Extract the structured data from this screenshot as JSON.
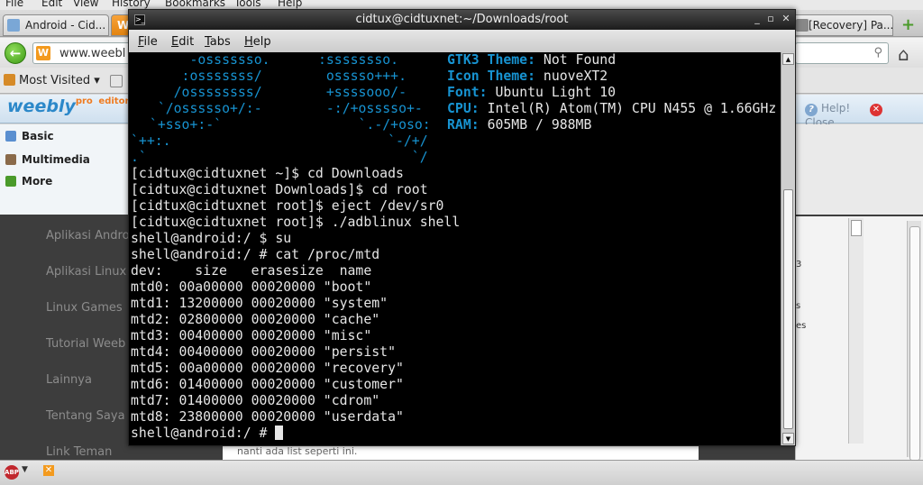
{
  "browser": {
    "menu": [
      "File",
      "Edit",
      "View",
      "History",
      "Bookmarks",
      "Tools",
      "Help"
    ],
    "tabs": [
      {
        "label": "Android - Cid..."
      },
      {
        "label": "W"
      },
      {
        "label": "[Recovery] Pa..."
      }
    ],
    "new_tab_label": "+",
    "url_partial": "www.weebl",
    "bookmarks_label": "Most Visited",
    "weebly_logo": "weebly",
    "weebly_logo_sup": "pro",
    "weebly_editor_label": "editor",
    "help_label": "Help!",
    "close_label": "Close",
    "sidebar": [
      {
        "label": "Basic"
      },
      {
        "label": "Multimedia"
      },
      {
        "label": "More"
      }
    ],
    "page_links": [
      "Aplikasi Andro",
      "Aplikasi Linux",
      "Linux Games",
      "Tutorial Weeb",
      "Lainnya",
      "Tentang Saya",
      "Link Teman"
    ],
    "page_text": "nanti ada list seperti ini.",
    "right_fragments": [
      "3",
      "s",
      "es"
    ]
  },
  "terminal": {
    "title": "cidtux@cidtuxnet:~/Downloads/root",
    "menu": [
      {
        "label": "File",
        "mnemonic": "F",
        "rest": "ile"
      },
      {
        "label": "Edit",
        "mnemonic": "E",
        "rest": "dit"
      },
      {
        "label": "Tabs",
        "mnemonic": "T",
        "rest": "abs"
      },
      {
        "label": "Help",
        "mnemonic": "H",
        "rest": "elp"
      }
    ],
    "art": [
      "      -osssssso.      :ssssssso.",
      "     :osssssss/        osssso+++.",
      "    /ossssssss/        +ssssooo/-",
      "  `/ossssso+/:-        -:/+osssso+-",
      " `+sso+:-`                 `.-/+oso:",
      "`++:.                           `-/+/",
      ".`                                 `/"
    ],
    "sysinfo": [
      {
        "key": "GTK3 Theme:",
        "value": "Not Found"
      },
      {
        "key": "Icon Theme:",
        "value": "nuoveXT2"
      },
      {
        "key": "Font:",
        "value": "Ubuntu Light 10"
      },
      {
        "key": "CPU:",
        "value": "Intel(R) Atom(TM) CPU N455 @ 1.66GHz"
      },
      {
        "key": "RAM:",
        "value": "605MB / 988MB"
      }
    ],
    "lines": [
      "[cidtux@cidtuxnet ~]$ cd Downloads",
      "[cidtux@cidtuxnet Downloads]$ cd root",
      "[cidtux@cidtuxnet root]$ eject /dev/sr0",
      "[cidtux@cidtuxnet root]$ ./adblinux shell",
      "shell@android:/ $ su",
      "shell@android:/ # cat /proc/mtd",
      "dev:    size   erasesize  name",
      "mtd0: 00a00000 00020000 \"boot\"",
      "mtd1: 13200000 00020000 \"system\"",
      "mtd2: 02800000 00020000 \"cache\"",
      "mtd3: 00400000 00020000 \"misc\"",
      "mtd4: 00400000 00020000 \"persist\"",
      "mtd5: 00a00000 00020000 \"recovery\"",
      "mtd6: 01400000 00020000 \"customer\"",
      "mtd7: 01400000 00020000 \"cdrom\"",
      "mtd8: 23800000 00020000 \"userdata\""
    ],
    "prompt": "shell@android:/ # "
  },
  "colors": {
    "terminal_bg": "#000000",
    "terminal_fg": "#e6e6e6",
    "arch_blue": "#1793d1"
  }
}
